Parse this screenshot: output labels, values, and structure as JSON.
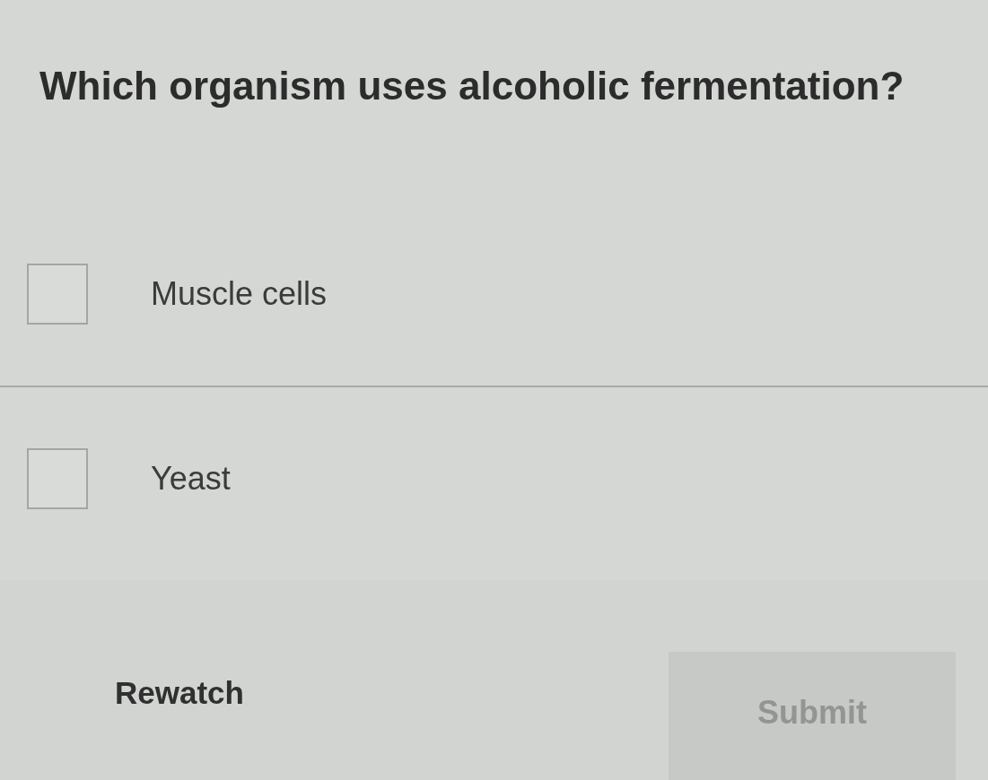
{
  "question": "Which organism uses alcoholic fermentation?",
  "options": [
    {
      "label": "Muscle cells",
      "checked": false
    },
    {
      "label": "Yeast",
      "checked": false
    }
  ],
  "footer": {
    "rewatch": {
      "label": "Rewatch"
    },
    "submit": {
      "label": "Submit",
      "disabled": true
    }
  }
}
